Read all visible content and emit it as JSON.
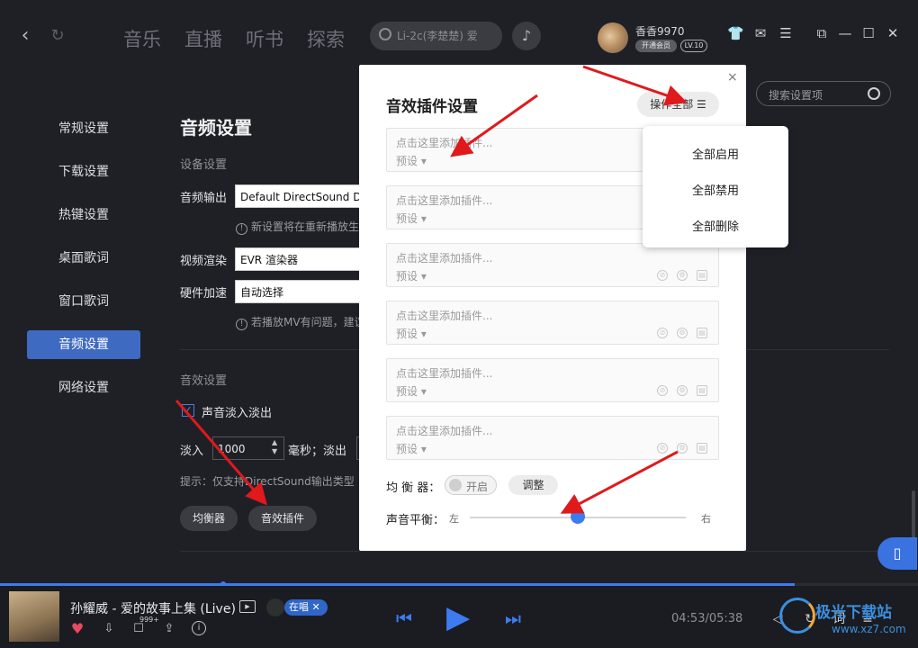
{
  "top_nav": {
    "tabs": [
      "音乐",
      "直播",
      "听书",
      "探索"
    ],
    "search_placeholder": "Li-2c(李楚楚) 爱",
    "username": "香香9970",
    "vip_label": "开通会员",
    "level": "LV.10"
  },
  "sidebar": {
    "items": [
      {
        "label": "常规设置"
      },
      {
        "label": "下载设置"
      },
      {
        "label": "热键设置"
      },
      {
        "label": "桌面歌词"
      },
      {
        "label": "窗口歌词"
      },
      {
        "label": "音频设置",
        "active": true
      },
      {
        "label": "网络设置"
      }
    ]
  },
  "settings": {
    "title": "音频设置",
    "search_placeholder": "搜索设置项",
    "device_section": "设备设置",
    "audio_output_label": "音频输出",
    "audio_output_value": "Default DirectSound De",
    "audio_output_hint": "新设置将在重新播放生",
    "video_render_label": "视频渲染",
    "video_render_value": "EVR 渲染器",
    "hw_accel_label": "硬件加速",
    "hw_accel_value": "自动选择",
    "hw_hint": "若播放MV有问题，建议",
    "effect_section": "音效设置",
    "fade_label": "声音淡入淡出",
    "fade_in_label": "淡入",
    "fade_in_value": "1000",
    "fade_unit": "毫秒；淡出",
    "tip": "提示：仅支持DirectSound输出类型",
    "eq_button": "均衡器",
    "plugin_button": "音效插件"
  },
  "modal": {
    "title": "音效插件设置",
    "close": "×",
    "operate_all": "操作全部",
    "slots": [
      {
        "text": "点击这里添加插件...",
        "preset": "预设"
      },
      {
        "text": "点击这里添加插件...",
        "preset": "预设"
      },
      {
        "text": "点击这里添加插件...",
        "preset": "预设"
      },
      {
        "text": "点击这里添加插件...",
        "preset": "预设"
      },
      {
        "text": "点击这里添加插件...",
        "preset": "预设"
      },
      {
        "text": "点击这里添加插件...",
        "preset": "预设"
      }
    ],
    "eq_label": "均 衡 器：",
    "eq_toggle": "开启",
    "adjust": "调整",
    "balance_label": "声音平衡：",
    "balance_left": "左",
    "balance_right": "右",
    "balance_value": 0.5
  },
  "dropdown": {
    "items": [
      "全部启用",
      "全部禁用",
      "全部删除"
    ]
  },
  "player": {
    "song": "孙耀威 - 爱的故事上集 (Live)",
    "live_tag": "在唱",
    "comment_count": "999+",
    "time": "04:53/05:38",
    "progress": 0.866,
    "lyrics_btn": "词"
  },
  "watermark": {
    "title": "极光下载站",
    "url": "www.xz7.com"
  },
  "colors": {
    "accent": "#3d7bf0",
    "sidebar_active": "#3e6ac2",
    "arrow": "#e0191c"
  }
}
